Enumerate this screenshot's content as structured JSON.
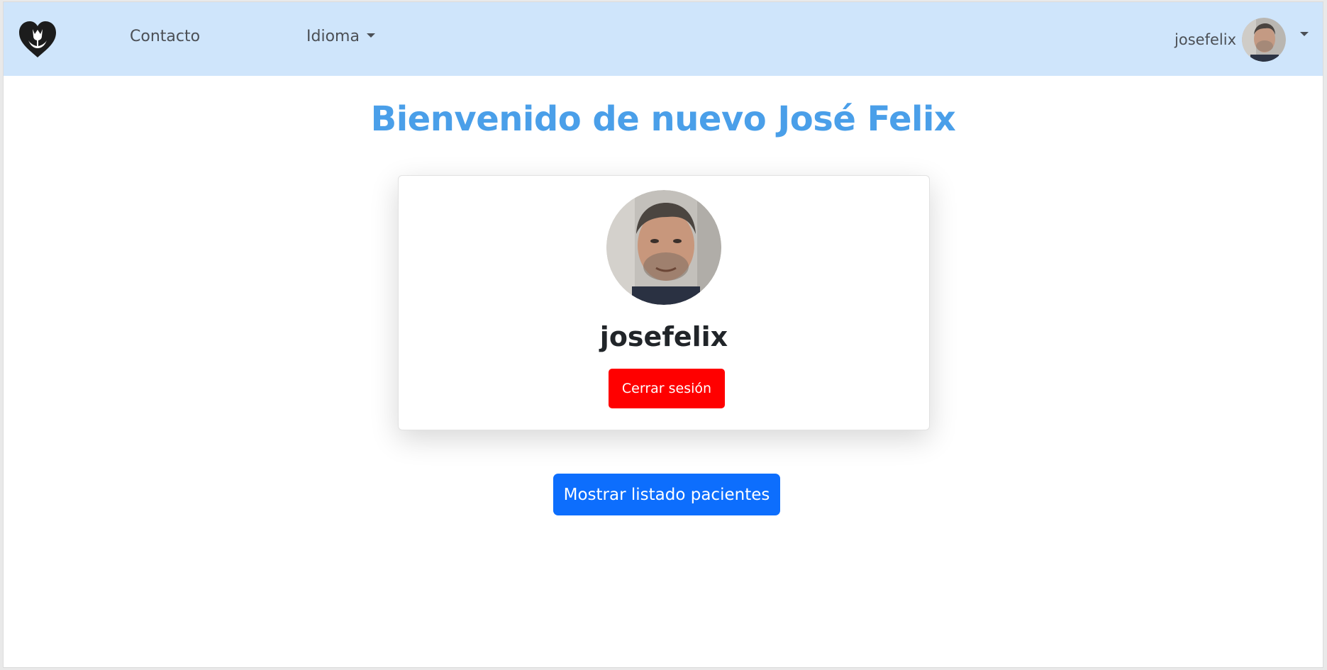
{
  "navbar": {
    "logo_icon": "heart-hands-logo-icon",
    "links": [
      {
        "label": "Contacto"
      },
      {
        "label": "Idioma",
        "has_dropdown": true
      }
    ],
    "user": {
      "username": "josefelix",
      "avatar_icon": "user-avatar-icon",
      "has_dropdown": true
    },
    "background_color": "#cfe5fb"
  },
  "main": {
    "welcome_heading": "Bienvenido de nuevo José Felix",
    "heading_color": "#4a9fe9",
    "profile_card": {
      "username": "josefelix",
      "logout_label": "Cerrar sesión",
      "logout_color": "#ff0000"
    },
    "show_patients_label": "Mostrar listado pacientes",
    "show_patients_color": "#0d6efd"
  }
}
